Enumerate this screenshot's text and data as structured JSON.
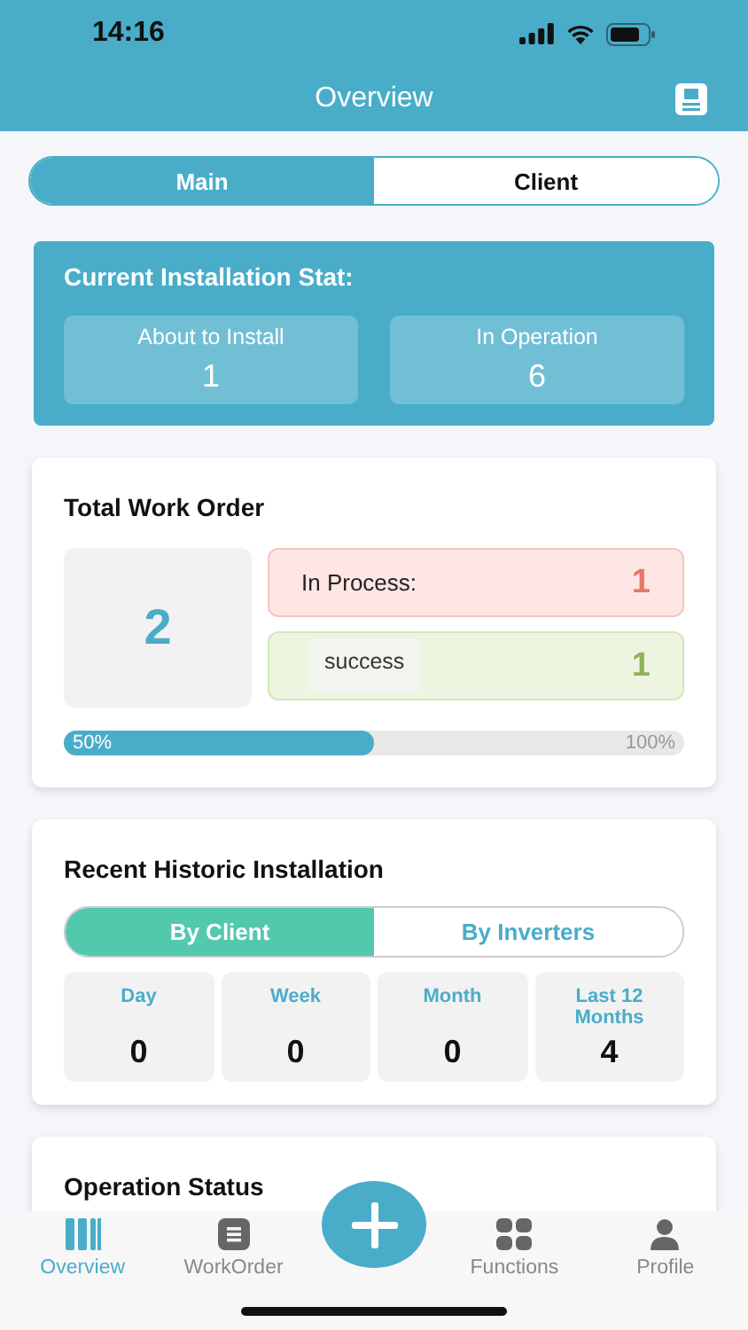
{
  "status_bar": {
    "time": "14:16"
  },
  "header": {
    "title": "Overview"
  },
  "segments": [
    {
      "label": "Main",
      "selected": true
    },
    {
      "label": "Client",
      "selected": false
    }
  ],
  "installation_stat": {
    "title": "Current Installation Stat:",
    "items": [
      {
        "label": "About to Install",
        "value": "1"
      },
      {
        "label": "In Operation",
        "value": "6"
      }
    ]
  },
  "work_order": {
    "title": "Total Work Order",
    "total": "2",
    "rows": [
      {
        "kind": "process",
        "label": "In Process:",
        "value": "1"
      },
      {
        "kind": "done",
        "value": "1"
      }
    ],
    "progress": {
      "level": 0.5,
      "start_label": "50%",
      "end_label": "100%"
    },
    "toast": "success"
  },
  "historic": {
    "title": "Recent Historic Installation",
    "tabs": [
      {
        "label": "By Client",
        "selected": true
      },
      {
        "label": "By Inverters",
        "selected": false
      }
    ],
    "periods": [
      {
        "label": "Day",
        "value": "0"
      },
      {
        "label": "Week",
        "value": "0"
      },
      {
        "label": "Month",
        "value": "0"
      },
      {
        "label": "Last 12 Months",
        "value": "4"
      }
    ]
  },
  "operation_status": {
    "title": "Operation Status"
  },
  "tab_bar": [
    {
      "kind": "overview",
      "label": "Overview",
      "selected": true
    },
    {
      "kind": "workorder",
      "label": "WorkOrder",
      "selected": false
    },
    {
      "kind": "add"
    },
    {
      "kind": "functions",
      "label": "Functions",
      "selected": false
    },
    {
      "kind": "profile",
      "label": "Profile",
      "selected": false
    }
  ]
}
